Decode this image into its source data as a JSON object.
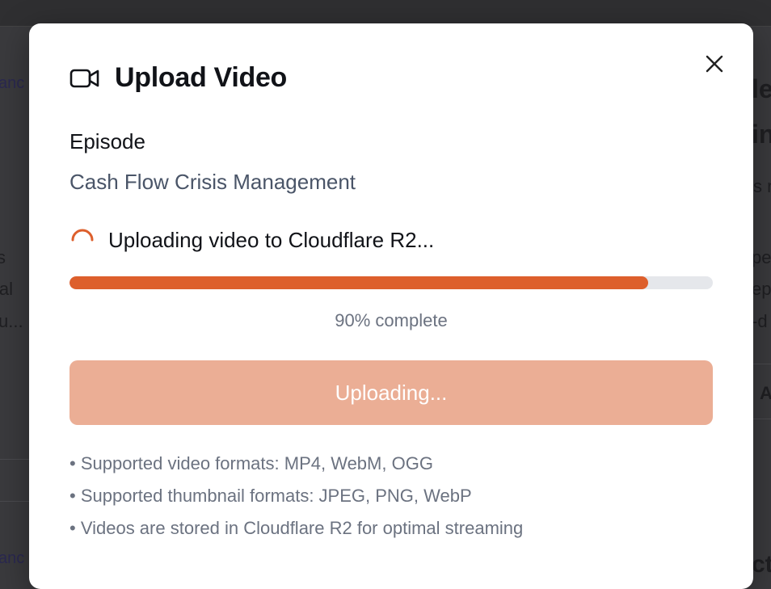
{
  "background": {
    "left_fragments": [
      "anc",
      "s",
      "ial",
      "u...",
      "anc"
    ],
    "right_fragments": [
      "le",
      "in",
      "s n",
      "pe",
      "ep",
      "-d",
      "A",
      "cti"
    ]
  },
  "modal": {
    "title": "Upload Video",
    "title_icon": "video-camera-icon",
    "close_icon": "close-icon",
    "episode_label": "Episode",
    "episode_name": "Cash Flow Crisis Management",
    "status_text": "Uploading video to Cloudflare R2...",
    "progress_fraction": 0.9,
    "progress_text": "90% complete",
    "upload_button_label": "Uploading...",
    "info_items": [
      "Supported video formats: MP4, WebM, OGG",
      "Supported thumbnail formats: JPEG, PNG, WebP",
      "Videos are stored in Cloudflare R2 for optimal streaming"
    ],
    "colors": {
      "accent": "#dd5f2c",
      "accent_disabled": "#ebae95",
      "track": "#e5e7eb"
    }
  }
}
